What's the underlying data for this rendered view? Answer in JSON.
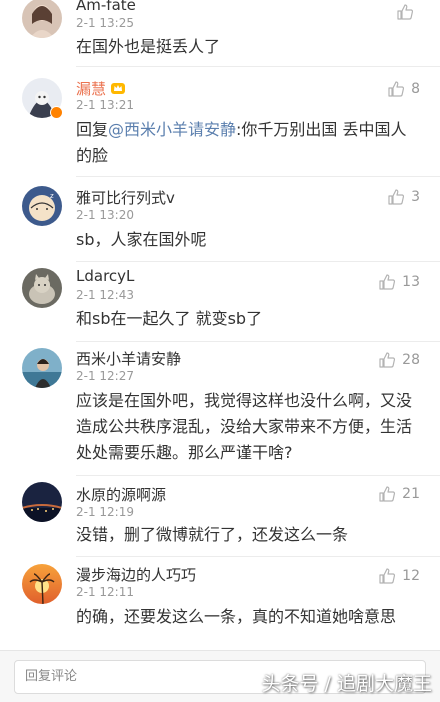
{
  "comments": [
    {
      "name": "Am-fate",
      "time": "2-1 13:25",
      "text": "在国外也是挺丢人了",
      "likes": "",
      "avatar_icon": "girl-portrait-avatar"
    },
    {
      "name": "漏慧",
      "time": "2-1 13:21",
      "reply_prefix": "回复",
      "mention": "@西米小羊请安静",
      "text": ":你千万别出国 丢中国人的脸",
      "likes": "8",
      "avatar_icon": "hooded-figure-avatar",
      "name_color": "#eb7350"
    },
    {
      "name": "雅可比行列式v",
      "time": "2-1 13:20",
      "text": "sb，人家在国外呢",
      "likes": "3",
      "avatar_icon": "cartoon-sleeping-avatar"
    },
    {
      "name": "LdarcyL",
      "time": "2-1 12:43",
      "text": "和sb在一起久了 就变sb了",
      "likes": "13",
      "avatar_icon": "cat-photo-avatar"
    },
    {
      "name": "西米小羊请安静",
      "time": "2-1 12:27",
      "text": "应该是在国外吧，我觉得这样也没什么啊，又没造成公共秩序混乱，没给大家带来不方便，生活处处需要乐趣。那么严谨干啥?",
      "likes": "28",
      "avatar_icon": "seaside-portrait-avatar"
    },
    {
      "name": "水原的源啊源",
      "time": "2-1 12:19",
      "text": "没错，删了微博就行了，还发这么一条",
      "likes": "21",
      "avatar_icon": "night-city-avatar"
    },
    {
      "name": "漫步海边的人巧巧",
      "time": "2-1 12:11",
      "text": "的确，还要发这么一条，真的不知道她啥意思",
      "likes": "12",
      "avatar_icon": "sunset-palm-avatar"
    }
  ],
  "reply_box": {
    "placeholder": "回复评论"
  },
  "watermark": "头条号 / 追剧大魔王",
  "colors": {
    "accent_name": "#eb7350",
    "mention": "#5b7fae",
    "muted": "#999999"
  }
}
